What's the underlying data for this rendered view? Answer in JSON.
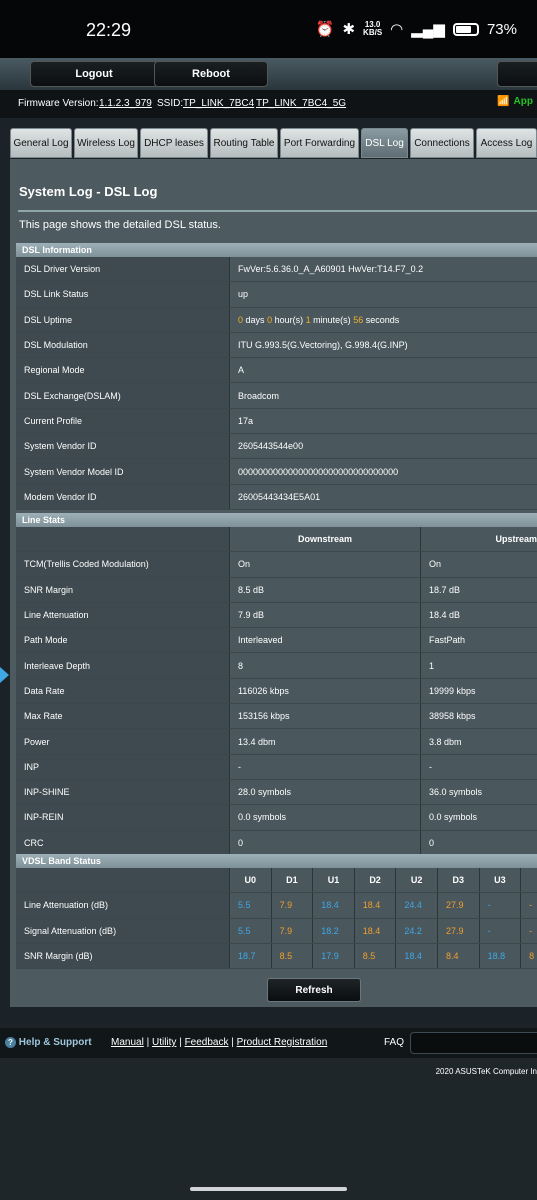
{
  "status_bar": {
    "time": "22:29",
    "net_speed_top": "13.0",
    "net_speed_bottom": "KB/S",
    "battery": "73%",
    "battery_level": 0.73
  },
  "header": {
    "logout": "Logout",
    "reboot": "Reboot",
    "firmware_label": "Firmware Version:",
    "firmware_value": "1.1.2.3_979",
    "ssid_label": "SSID:",
    "ssid_1": "TP_LINK_7BC4",
    "ssid_2": "TP_LINK_7BC4_5G",
    "app_label": "App"
  },
  "tabs": [
    "General Log",
    "Wireless Log",
    "DHCP leases",
    "Routing Table",
    "Port Forwarding",
    "DSL Log",
    "Connections",
    "Access Log"
  ],
  "page": {
    "title": "System Log - DSL Log",
    "description": "This page shows the detailed DSL status."
  },
  "dsl_info": {
    "heading": "DSL Information",
    "rows": [
      {
        "label": "DSL Driver Version",
        "value": "FwVer:5.6.36.0_A_A60901 HwVer:T14.F7_0.2"
      },
      {
        "label": "DSL Link Status",
        "value": "up"
      },
      {
        "label": "DSL Uptime",
        "days": "0",
        "days_unit": "days",
        "hours": "0",
        "hours_unit": "hour(s)",
        "minutes": "1",
        "minutes_unit": "minute(s)",
        "seconds": "56",
        "seconds_unit": "seconds"
      },
      {
        "label": "DSL Modulation",
        "value": "ITU G.993.5(G.Vectoring), G.998.4(G.INP)"
      },
      {
        "label": "Regional Mode",
        "value": "A"
      },
      {
        "label": "DSL Exchange(DSLAM)",
        "value": "Broadcom"
      },
      {
        "label": "Current Profile",
        "value": "17a"
      },
      {
        "label": "System Vendor ID",
        "value": "2605443544e00"
      },
      {
        "label": "System Vendor Model ID",
        "value": "00000000000000000000000000000000"
      },
      {
        "label": "Modem Vendor ID",
        "value": "26005443434E5A01"
      }
    ]
  },
  "line_stats": {
    "heading": "Line Stats",
    "col_downstream": "Downstream",
    "col_upstream": "Upstream",
    "rows": [
      {
        "label": "TCM(Trellis Coded Modulation)",
        "down": "On",
        "up": "On"
      },
      {
        "label": "SNR Margin",
        "down": "8.5 dB",
        "up": "18.7 dB"
      },
      {
        "label": "Line Attenuation",
        "down": "7.9 dB",
        "up": "18.4 dB"
      },
      {
        "label": "Path Mode",
        "down": "Interleaved",
        "up": "FastPath"
      },
      {
        "label": "Interleave Depth",
        "down": "8",
        "up": "1"
      },
      {
        "label": "Data Rate",
        "down": "116026 kbps",
        "up": "19999 kbps"
      },
      {
        "label": "Max Rate",
        "down": "153156 kbps",
        "up": "38958 kbps"
      },
      {
        "label": "Power",
        "down": "13.4 dbm",
        "up": "3.8 dbm"
      },
      {
        "label": "INP",
        "down": "-",
        "up": "-"
      },
      {
        "label": "INP-SHINE",
        "down": "28.0 symbols",
        "up": "36.0 symbols"
      },
      {
        "label": "INP-REIN",
        "down": "0.0 symbols",
        "up": "0.0 symbols"
      },
      {
        "label": "CRC",
        "down": "0",
        "up": "0"
      }
    ]
  },
  "vdsl": {
    "heading": "VDSL Band Status",
    "bands": [
      "U0",
      "D1",
      "U1",
      "D2",
      "U2",
      "D3",
      "U3",
      ""
    ],
    "rows": [
      {
        "label": "Line Attenuation (dB)",
        "values": [
          "5.5",
          "7.9",
          "18.4",
          "18.4",
          "24.4",
          "27.9",
          "-",
          "-"
        ]
      },
      {
        "label": "Signal Attenuation (dB)",
        "values": [
          "5.5",
          "7.9",
          "18.2",
          "18.4",
          "24.2",
          "27.9",
          "-",
          "-"
        ]
      },
      {
        "label": "SNR Margin (dB)",
        "values": [
          "18.7",
          "8.5",
          "17.9",
          "8.5",
          "18.4",
          "8.4",
          "18.8",
          "8"
        ]
      }
    ]
  },
  "refresh": "Refresh",
  "footer": {
    "help": "Help & Support",
    "manual": "Manual",
    "utility": "Utility",
    "feedback": "Feedback",
    "registration": "Product Registration",
    "faq": "FAQ",
    "copyright": "2020 ASUSTeK Computer In"
  },
  "colors": {
    "upstream_band": "#3ea8e6",
    "downstream_band": "#f0a02c",
    "uptime_number": "#f0b02a",
    "wifi": "#22c322"
  }
}
